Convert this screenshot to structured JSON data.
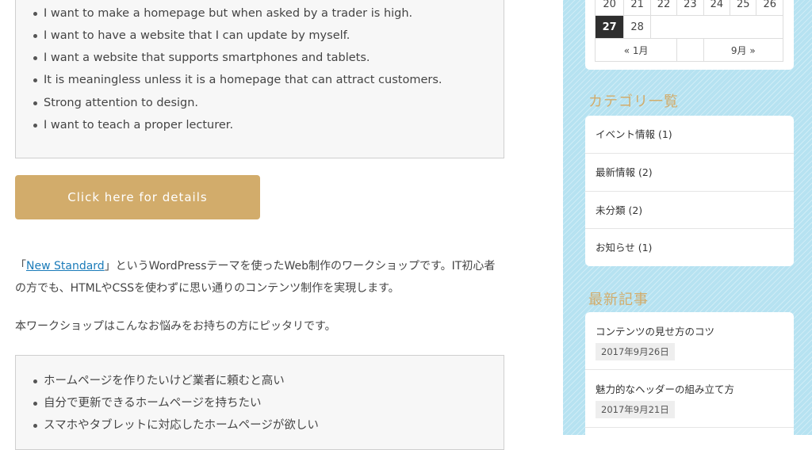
{
  "main": {
    "box1_items": [
      "I want to make a homepage but when asked by a trader is high.",
      "I want to have a website that I can update by myself.",
      "I want a website that supports smartphones and tablets.",
      "It is meaningless unless it is a homepage that can attract customers.",
      "Strong attention to design.",
      "I want to teach a proper lecturer."
    ],
    "button_label": "Click here for details",
    "para1": {
      "open_bracket": "「",
      "link": "New Standard",
      "rest_line1": "」というWordPressテーマを使ったWeb制作のワークショップです。IT初心者",
      "line2": "の方でも、HTMLやCSSを使わずに思い通りのコンテンツ制作を実現します。"
    },
    "para2": "本ワークショップはこんなお悩みをお持ちの方にピッタリです。",
    "box2_items": [
      "ホームページを作りたいけど業者に頼むと高い",
      "自分で更新できるホームページを持ちたい",
      "スマホやタブレットに対応したホームページが欲しい"
    ]
  },
  "sidebar": {
    "calendar": {
      "row_partial": [
        "20",
        "21",
        "22",
        "23",
        "24",
        "25",
        "26"
      ],
      "row_last": [
        "27",
        "28"
      ],
      "prev": "« 1月",
      "next": "9月 »"
    },
    "categories": {
      "title": "カテゴリ一覧",
      "items": [
        "イベント情報 (1)",
        "最新情報 (2)",
        "未分類 (2)",
        "お知らせ (1)"
      ]
    },
    "recent": {
      "title": "最新記事",
      "posts": [
        {
          "title": "コンテンツの見せ方のコツ",
          "date": "2017年9月26日"
        },
        {
          "title": "魅力的なヘッダーの組み立て方",
          "date": "2017年9月21日"
        }
      ]
    }
  }
}
